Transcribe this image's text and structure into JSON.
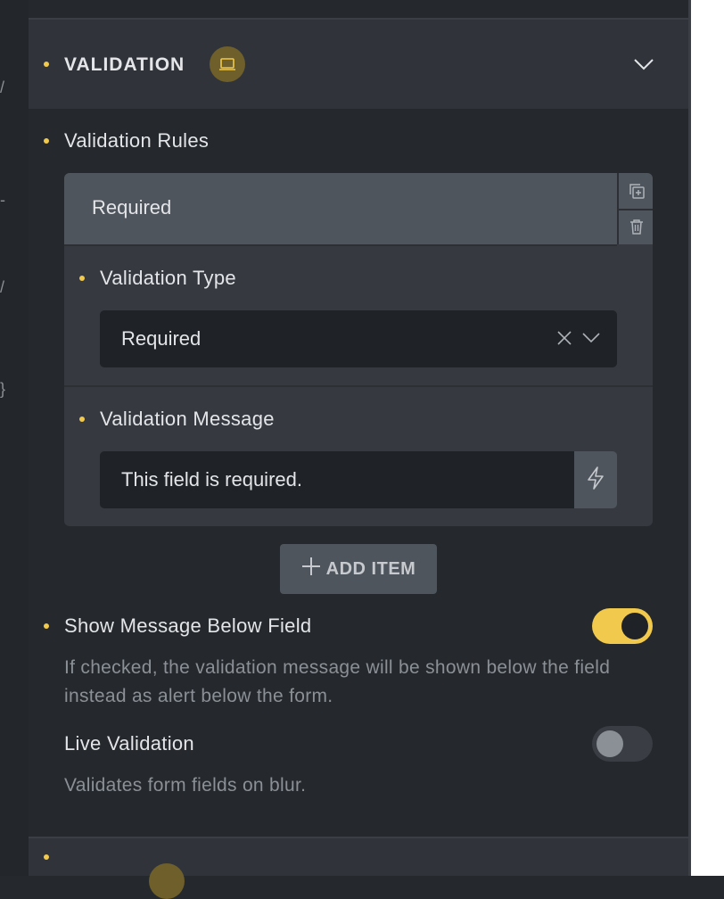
{
  "section": {
    "title": "VALIDATION",
    "badge_icon": "laptop-icon",
    "toggle_icon": "chevron-down-icon"
  },
  "validation_rules": {
    "label": "Validation Rules",
    "items": [
      {
        "title": "Required",
        "actions": [
          "duplicate-icon",
          "trash-icon"
        ],
        "validation_type": {
          "label": "Validation Type",
          "selected": "Required"
        },
        "validation_message": {
          "label": "Validation Message",
          "value": "This field is required."
        }
      }
    ],
    "add_item_label": "ADD ITEM"
  },
  "show_message_below": {
    "label": "Show Message Below Field",
    "enabled": true,
    "description": "If checked, the validation message will be shown below the field instead as alert below the form."
  },
  "live_validation": {
    "label": "Live Validation",
    "enabled": false,
    "description": "Validates form fields on blur."
  },
  "colors": {
    "accent": "#f0c94d",
    "panel_bg": "#25282c",
    "header_bg": "#30343a",
    "input_bg": "#1f2226"
  }
}
